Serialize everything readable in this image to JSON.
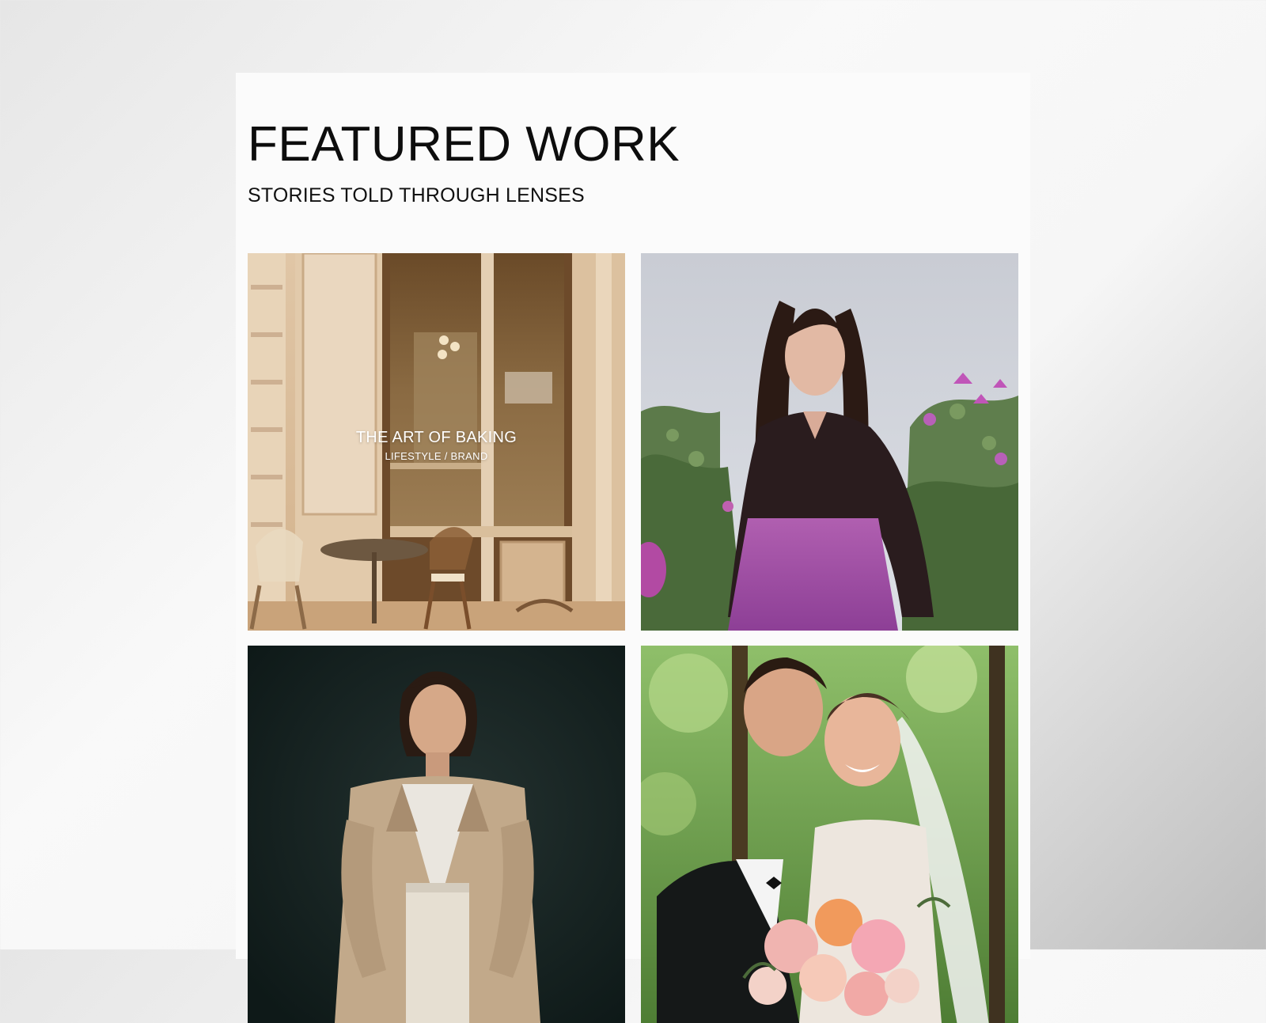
{
  "section": {
    "title": "FEATURED WORK",
    "subtitle": "STORIES TOLD THROUGH LENSES"
  },
  "projects": [
    {
      "title": "THE ART OF BAKING",
      "category": "LIFESTYLE / BRAND",
      "image": "cafe-storefront-photo"
    },
    {
      "image": "woman-in-flower-field-photo"
    },
    {
      "image": "studio-portrait-woman-blazer-photo"
    },
    {
      "image": "wedding-couple-bouquet-photo"
    }
  ],
  "colors": {
    "page_background": "#fbfbfb",
    "title_text": "#0d0d0d",
    "overlay_text": "#ffffff"
  }
}
